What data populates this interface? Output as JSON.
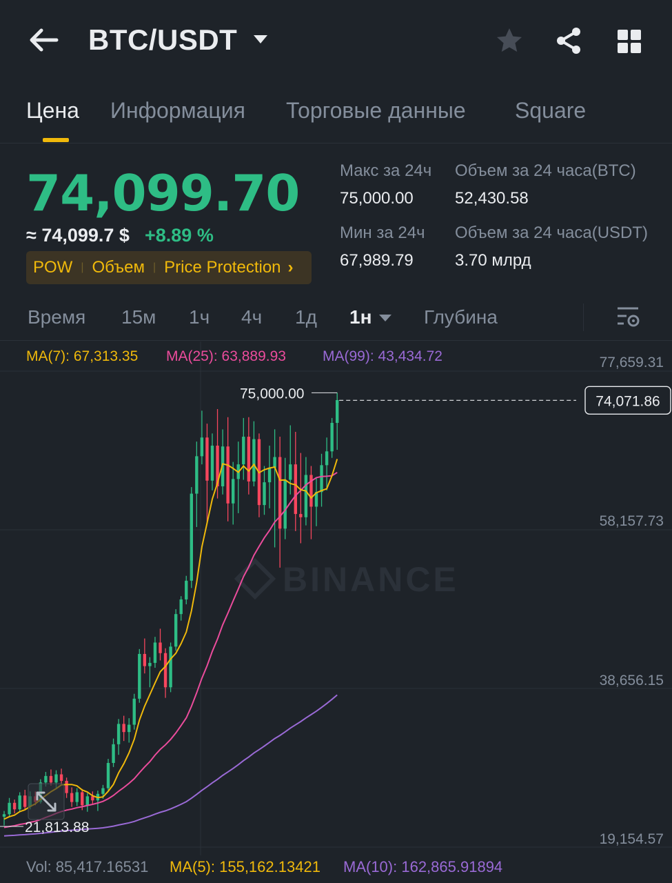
{
  "header": {
    "pair": "BTC/USDT",
    "icons": {
      "back": "arrow-left-icon",
      "caret": "caret-down-icon",
      "favorite": "star-icon",
      "share": "share-icon",
      "more": "grid-icon"
    }
  },
  "tabs": [
    {
      "label": "Цена",
      "active": true
    },
    {
      "label": "Информация",
      "active": false
    },
    {
      "label": "Торговые данные",
      "active": false
    },
    {
      "label": "Square",
      "active": false
    }
  ],
  "price": {
    "last": "74,099.70",
    "approx": "≈ 74,099.7 $",
    "change": "+8.89 %",
    "badges": [
      "POW",
      "Объем",
      "Price Protection"
    ]
  },
  "stats": {
    "high_label": "Макс за 24ч",
    "high_value": "75,000.00",
    "low_label": "Мин за 24ч",
    "low_value": "67,989.79",
    "vol_btc_label": "Объем за 24 часа(BTC)",
    "vol_btc_value": "52,430.58",
    "vol_usdt_label": "Объем за 24 часа(USDT)",
    "vol_usdt_value": "3.70 млрд"
  },
  "intervals": [
    {
      "label": "Время",
      "active": false
    },
    {
      "label": "15м",
      "active": false
    },
    {
      "label": "1ч",
      "active": false
    },
    {
      "label": "4ч",
      "active": false
    },
    {
      "label": "1д",
      "active": false
    },
    {
      "label": "1н",
      "active": true
    },
    {
      "label": "Глубина",
      "active": false
    }
  ],
  "indicators": {
    "ma7": "MA(7): 67,313.35",
    "ma25": "MA(25): 63,889.93",
    "ma99": "MA(99): 43,434.72"
  },
  "chart_data": {
    "type": "candlestick",
    "watermark": "BINANCE",
    "y_ticks": [
      "77,659.31",
      "58,157.73",
      "38,656.15",
      "19,154.57"
    ],
    "y_tick_values": [
      77659.31,
      58157.73,
      38656.15,
      19154.57
    ],
    "current_price_label": "74,071.86",
    "current_price": 74071.86,
    "max_label": "75,000.00",
    "max_value": 75000.0,
    "min_label": "21,813.88",
    "min_value": 21813.88,
    "colors": {
      "up": "#2ebd85",
      "down": "#f6465d",
      "ma7": "#f0b90b",
      "ma25": "#eb4c9c",
      "ma99": "#9a6ad6"
    },
    "candles": [
      [
        22900,
        23600,
        21814,
        23200
      ],
      [
        23200,
        25200,
        22800,
        24600
      ],
      [
        24600,
        25000,
        23300,
        23800
      ],
      [
        23800,
        25900,
        23500,
        25500
      ],
      [
        25500,
        26200,
        23700,
        24100
      ],
      [
        24100,
        26000,
        23800,
        25400
      ],
      [
        25400,
        26000,
        24300,
        24700
      ],
      [
        24700,
        27500,
        24500,
        27100
      ],
      [
        27100,
        28400,
        26600,
        27900
      ],
      [
        27900,
        28700,
        26700,
        27100
      ],
      [
        27100,
        28600,
        26300,
        28100
      ],
      [
        28100,
        28800,
        26800,
        27300
      ],
      [
        27300,
        27700,
        25200,
        25800
      ],
      [
        25800,
        26500,
        24100,
        24700
      ],
      [
        24700,
        26400,
        24200,
        25900
      ],
      [
        25900,
        26300,
        23700,
        24300
      ],
      [
        24300,
        25800,
        23500,
        25400
      ],
      [
        25400,
        26000,
        24400,
        24900
      ],
      [
        24900,
        26100,
        23600,
        25700
      ],
      [
        25700,
        26800,
        25100,
        26400
      ],
      [
        26400,
        30000,
        26100,
        29500
      ],
      [
        29500,
        32500,
        29000,
        31800
      ],
      [
        31800,
        34900,
        30500,
        34300
      ],
      [
        34300,
        35300,
        32200,
        33300
      ],
      [
        33300,
        35000,
        32000,
        34200
      ],
      [
        34200,
        38000,
        33600,
        37400
      ],
      [
        37400,
        43500,
        36900,
        42900
      ],
      [
        42900,
        44800,
        40500,
        41400
      ],
      [
        41400,
        42500,
        38800,
        41800
      ],
      [
        41800,
        45000,
        41200,
        44300
      ],
      [
        44300,
        46000,
        42100,
        43000
      ],
      [
        43000,
        43600,
        37500,
        38800
      ],
      [
        38800,
        44300,
        38200,
        43800
      ],
      [
        43800,
        48400,
        43300,
        47800
      ],
      [
        47800,
        50000,
        47000,
        49600
      ],
      [
        49600,
        52500,
        49000,
        51900
      ],
      [
        51900,
        63400,
        51000,
        62600
      ],
      [
        62600,
        69000,
        58500,
        67200
      ],
      [
        67200,
        72800,
        66200,
        69500
      ],
      [
        69500,
        71200,
        59000,
        64200
      ],
      [
        64200,
        70000,
        63000,
        68500
      ],
      [
        68500,
        73000,
        62000,
        63500
      ],
      [
        63500,
        70500,
        62500,
        68400
      ],
      [
        68400,
        72000,
        59200,
        61400
      ],
      [
        61400,
        66500,
        58800,
        64400
      ],
      [
        64400,
        69000,
        60200,
        66200
      ],
      [
        66200,
        71900,
        64300,
        69600
      ],
      [
        69600,
        72000,
        62500,
        64100
      ],
      [
        64100,
        71500,
        63500,
        69300
      ],
      [
        69300,
        70000,
        59700,
        61200
      ],
      [
        61200,
        66000,
        60000,
        64000
      ],
      [
        64000,
        68500,
        60800,
        65800
      ],
      [
        65800,
        70500,
        56000,
        67100
      ],
      [
        67100,
        69600,
        53500,
        58300
      ],
      [
        58300,
        67000,
        57000,
        64300
      ],
      [
        64300,
        71000,
        62500,
        66200
      ],
      [
        66200,
        70200,
        58000,
        60100
      ],
      [
        60100,
        67600,
        56500,
        59700
      ],
      [
        59700,
        67100,
        58700,
        64900
      ],
      [
        64900,
        66000,
        57000,
        61000
      ],
      [
        61000,
        64500,
        58600,
        62800
      ],
      [
        62800,
        67500,
        61000,
        66100
      ],
      [
        66100,
        69500,
        63000,
        67800
      ],
      [
        67800,
        71900,
        67000,
        71300
      ],
      [
        71300,
        75000,
        67990,
        74100
      ]
    ]
  },
  "volume": {
    "vol": "Vol: 85,417.16531",
    "ma5": "MA(5): 155,162.13421",
    "ma10": "MA(10): 162,865.91894"
  }
}
